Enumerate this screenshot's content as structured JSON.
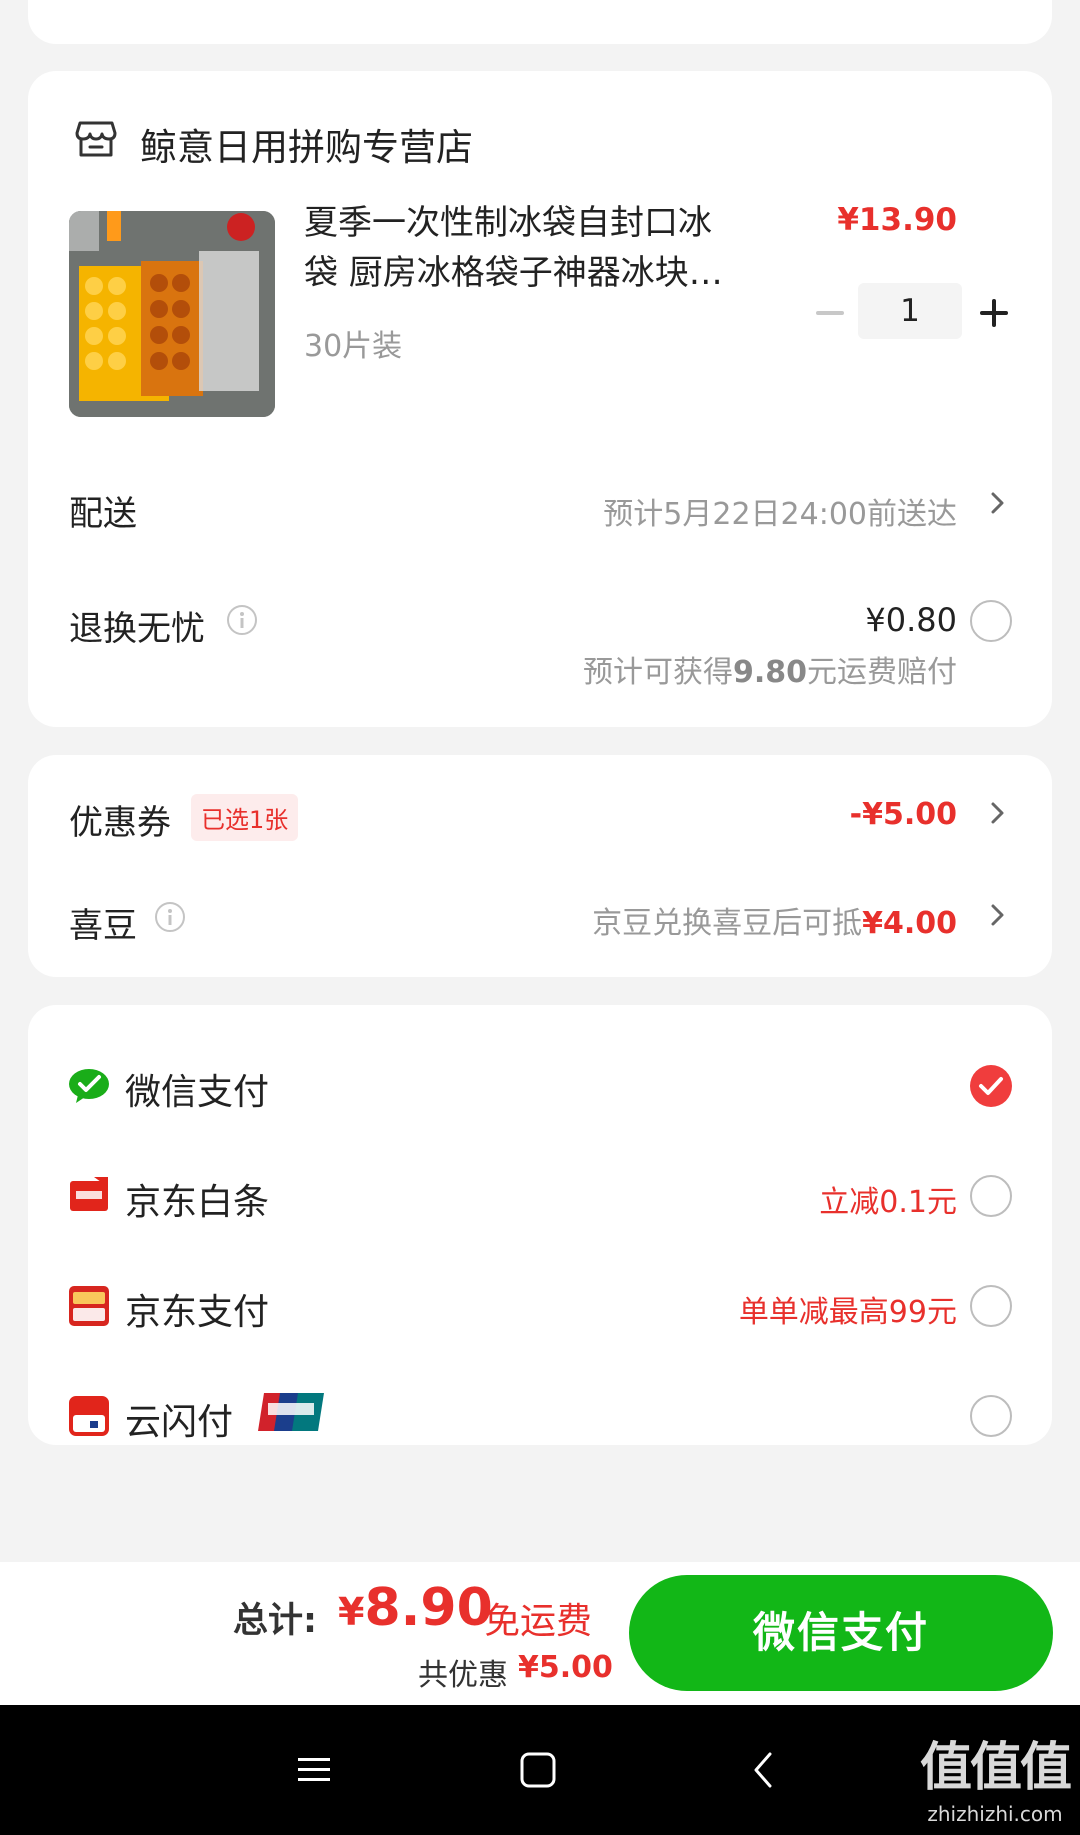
{
  "store": {
    "name": "鲸意日用拼购专营店",
    "icon": "store-icon"
  },
  "product": {
    "title_line1": "夏季一次性制冰袋自封口冰",
    "title_line2": "袋 厨房冰格袋子神器冰块…",
    "spec": "30片装",
    "price": "¥13.90",
    "quantity": "1"
  },
  "delivery": {
    "label": "配送",
    "value": "预计5月22日24:00前送达"
  },
  "return_insurance": {
    "label": "退换无忧",
    "price": "¥0.80",
    "note_prefix": "预计可获得",
    "note_amount": "9.80",
    "note_suffix": "元运费赔付",
    "selected": false
  },
  "coupon": {
    "label": "优惠券",
    "tag": "已选1张",
    "value": "-¥5.00"
  },
  "xidou": {
    "label": "喜豆",
    "value_prefix": "京豆兑换喜豆后可抵",
    "value_amount": "¥4.00"
  },
  "payment_methods": [
    {
      "label": "微信支付",
      "promo": "",
      "selected": true,
      "icon": "wechat-pay-icon"
    },
    {
      "label": "京东白条",
      "promo": "立减0.1元",
      "selected": false,
      "icon": "jd-baitiao-icon"
    },
    {
      "label": "京东支付",
      "promo": "单单减最高99元",
      "selected": false,
      "icon": "jd-pay-icon"
    },
    {
      "label": "云闪付",
      "promo": "",
      "selected": false,
      "icon": "cloud-quickpass-icon",
      "badge": "unionpay-logo"
    }
  ],
  "summary": {
    "total_label": "总计:",
    "total_yen": "¥",
    "total_amount": "8.90",
    "free_shipping": "免运费",
    "saving_label": "共优惠",
    "saving_amount": "¥5.00",
    "pay_button": "微信支付"
  },
  "watermark": {
    "big": "值值值",
    "small": "zhizhizhi.com"
  },
  "colors": {
    "accent_red": "#e8302c",
    "wechat_green": "#12b717",
    "background": "#f3f3f3"
  }
}
